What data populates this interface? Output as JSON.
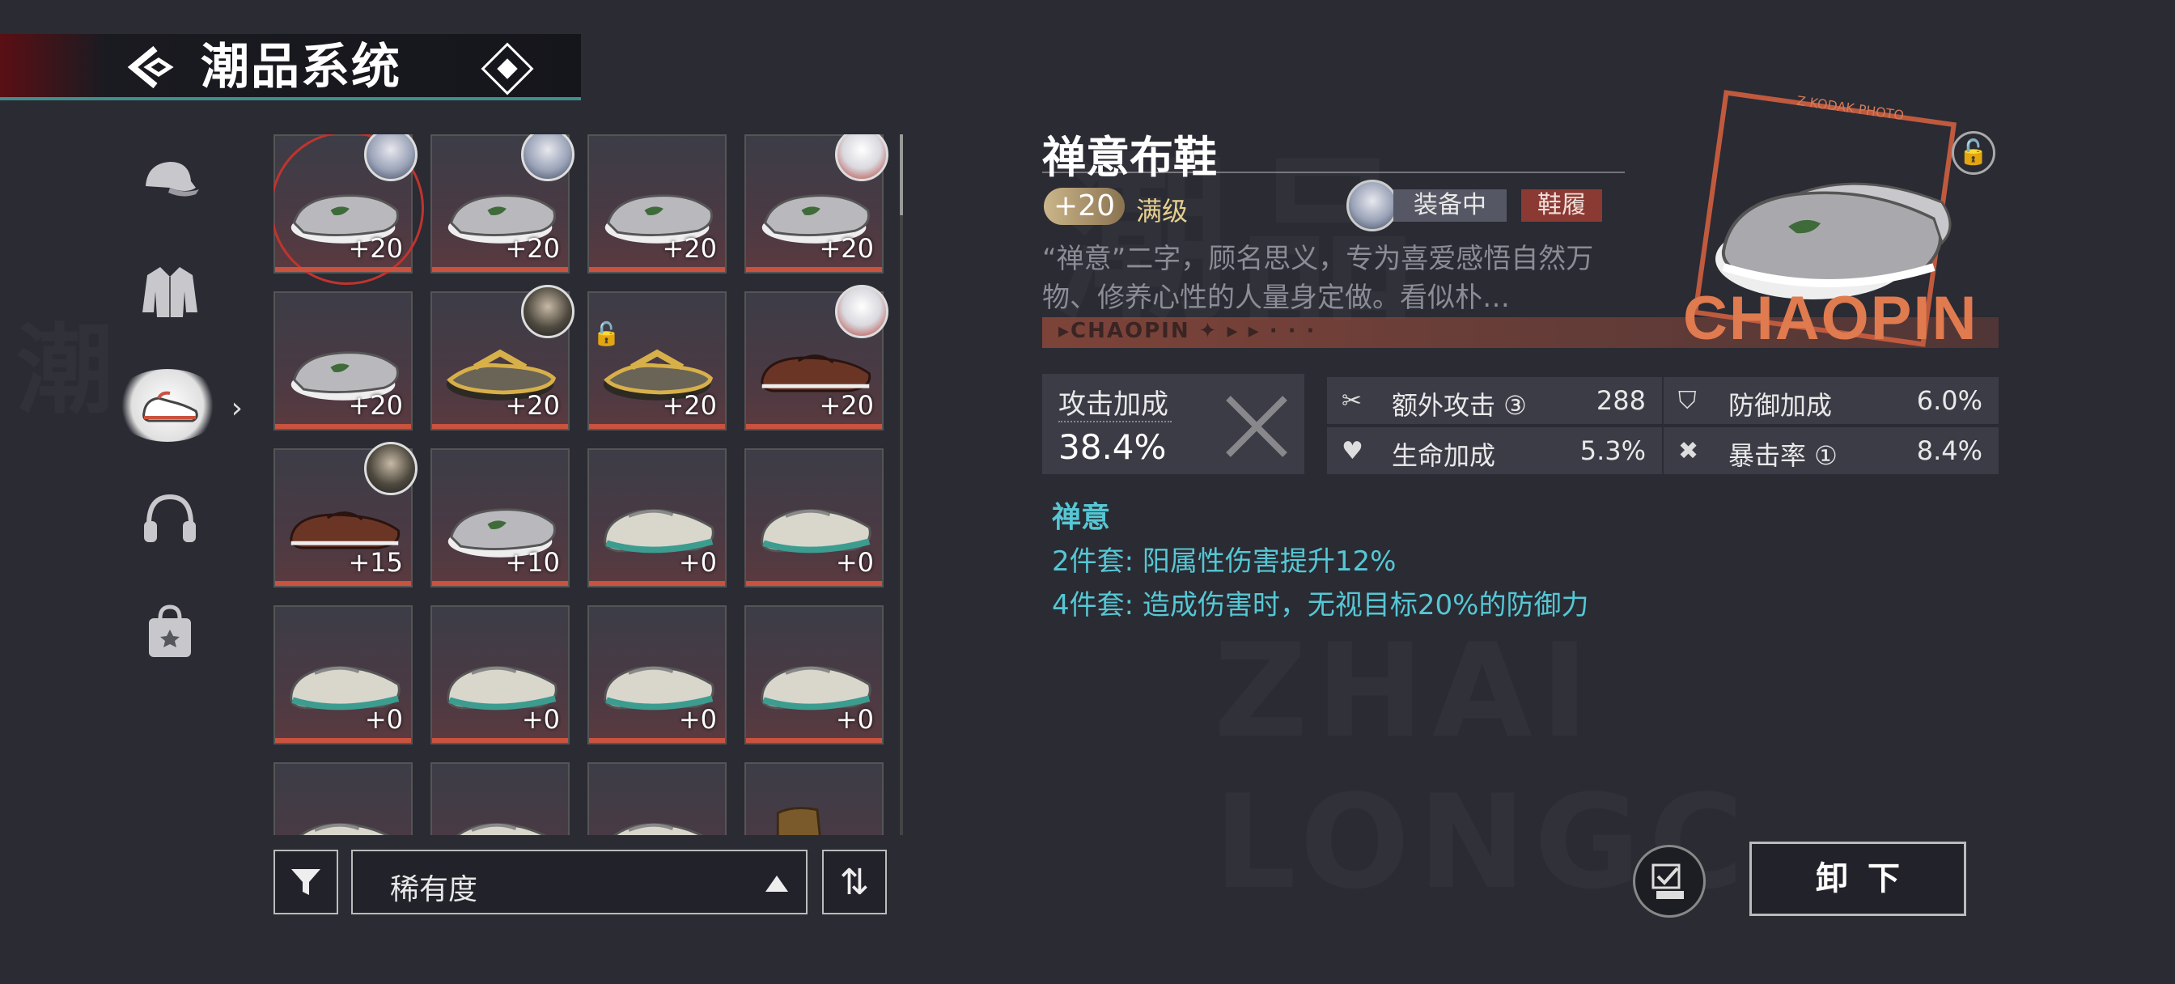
{
  "header": {
    "title": "潮品系统"
  },
  "categories": [
    {
      "icon": "cap-icon"
    },
    {
      "icon": "jacket-icon"
    },
    {
      "icon": "shoe-icon",
      "active": true
    },
    {
      "icon": "headphones-icon"
    },
    {
      "icon": "bag-icon"
    }
  ],
  "grid": {
    "items": [
      {
        "level": "+20",
        "shoe": "slipper",
        "avatar": "blue",
        "selected": true
      },
      {
        "level": "+20",
        "shoe": "slipper",
        "avatar": "white"
      },
      {
        "level": "+20",
        "shoe": "slipper"
      },
      {
        "level": "+20",
        "shoe": "slipper",
        "avatar": "red"
      },
      {
        "level": "+20",
        "shoe": "slipper"
      },
      {
        "level": "+20",
        "shoe": "sandal",
        "avatar": "dark"
      },
      {
        "level": "+20",
        "shoe": "sandal",
        "locked": true
      },
      {
        "level": "+20",
        "shoe": "leather",
        "avatar": "red"
      },
      {
        "level": "+15",
        "shoe": "leather",
        "avatar": "dark"
      },
      {
        "level": "+10",
        "shoe": "slipper"
      },
      {
        "level": "+0",
        "shoe": "sneaker"
      },
      {
        "level": "+0",
        "shoe": "sneaker"
      },
      {
        "level": "+0",
        "shoe": "sneaker"
      },
      {
        "level": "+0",
        "shoe": "sneaker"
      },
      {
        "level": "+0",
        "shoe": "sneaker"
      },
      {
        "level": "+0",
        "shoe": "sneaker"
      },
      {
        "level": "",
        "shoe": "sneaker"
      },
      {
        "level": "",
        "shoe": "sneaker"
      },
      {
        "level": "",
        "shoe": "sneaker"
      },
      {
        "level": "",
        "shoe": "boot"
      }
    ]
  },
  "controls": {
    "sort_label": "稀有度",
    "order_symbol": "⇅"
  },
  "detail": {
    "name": "禅意布鞋",
    "level": "+20",
    "max_label": "满级",
    "equip_status": "装备中",
    "slot": "鞋履",
    "description": "“禅意”二字，顾名思义，专为喜爱感悟自然万物、修养心性的人量身定做。看似朴…",
    "banner_text": "▸CHAOPIN ✦ ▸ ▸ · · ·",
    "card_brand": "CHAOPIN",
    "card_photo_label": "Z KODAK PHOTO",
    "main_stat": {
      "label": "攻击加成",
      "value": "38.4%"
    },
    "sub_stats": [
      {
        "icon": "extra-attack-icon",
        "label": "额外攻击 ③",
        "value": "288"
      },
      {
        "icon": "defense-icon",
        "label": "防御加成",
        "value": "6.0%"
      },
      {
        "icon": "health-icon",
        "label": "生命加成",
        "value": "5.3%"
      },
      {
        "icon": "crit-icon",
        "label": "暴击率 ①",
        "value": "8.4%"
      }
    ],
    "set": {
      "name": "禅意",
      "effects": [
        "2件套: 阳属性伤害提升12%",
        "4件套: 造成伤害时，无视目标20%的防御力"
      ]
    }
  },
  "actions": {
    "unequip_label": "卸下"
  },
  "colors": {
    "accent_teal": "#56c7d4",
    "accent_orange": "#e07a4f",
    "rarity_bar": "#c9533e"
  }
}
